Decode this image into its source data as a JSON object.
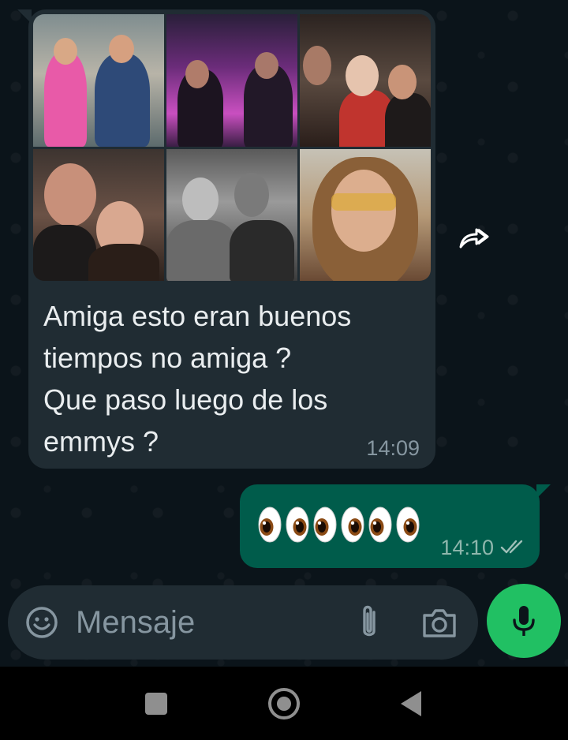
{
  "incoming_message": {
    "photos": [
      "photo-1",
      "photo-2",
      "photo-3",
      "photo-4",
      "photo-5",
      "photo-6"
    ],
    "text_lines": [
      "Amiga esto eran buenos",
      "tiempos no amiga ?",
      "Que paso luego de los",
      "emmys ?"
    ],
    "time": "14:09"
  },
  "outgoing_message": {
    "emoji": "👀👀👀",
    "emoji_count": 6,
    "time": "14:10",
    "status": "delivered"
  },
  "composer": {
    "placeholder": "Mensaje"
  },
  "colors": {
    "chat_bg": "#0b141a",
    "incoming_bubble": "#202c33",
    "outgoing_bubble": "#005c4b",
    "mic_button": "#21c063"
  },
  "icons": [
    "forward-icon",
    "emoji-icon",
    "paperclip-icon",
    "camera-icon",
    "mic-icon",
    "double-check-icon"
  ]
}
